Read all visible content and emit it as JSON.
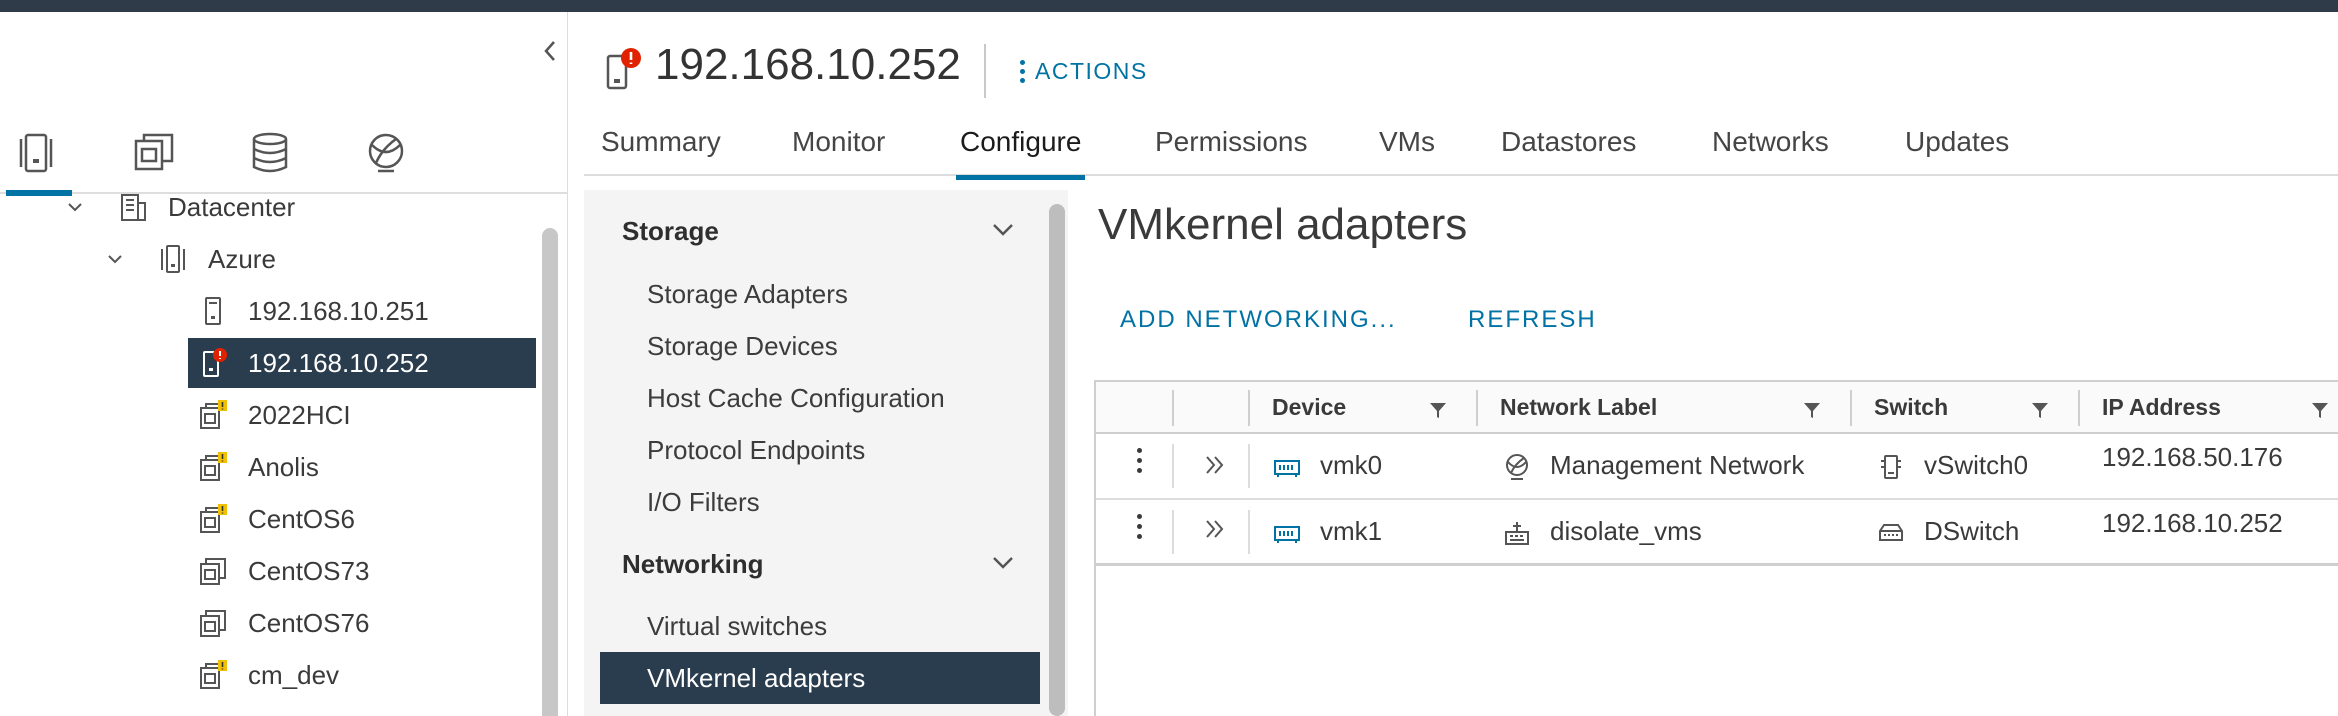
{
  "header": {
    "title": "192.168.10.252",
    "actions_label": "ACTIONS"
  },
  "tabs": [
    {
      "label": "Summary"
    },
    {
      "label": "Monitor"
    },
    {
      "label": "Configure"
    },
    {
      "label": "Permissions"
    },
    {
      "label": "VMs"
    },
    {
      "label": "Datastores"
    },
    {
      "label": "Networks"
    },
    {
      "label": "Updates"
    }
  ],
  "tree": {
    "items": [
      {
        "label": "Datacenter"
      },
      {
        "label": "Azure"
      },
      {
        "label": "192.168.10.251"
      },
      {
        "label": "192.168.10.252"
      },
      {
        "label": "2022HCI"
      },
      {
        "label": "Anolis"
      },
      {
        "label": "CentOS6"
      },
      {
        "label": "CentOS73"
      },
      {
        "label": "CentOS76"
      },
      {
        "label": "cm_dev"
      }
    ]
  },
  "config_menu": {
    "storage": {
      "title": "Storage",
      "items": [
        "Storage Adapters",
        "Storage Devices",
        "Host Cache Configuration",
        "Protocol Endpoints",
        "I/O Filters"
      ]
    },
    "networking": {
      "title": "Networking",
      "items": [
        "Virtual switches",
        "VMkernel adapters"
      ]
    }
  },
  "content": {
    "title": "VMkernel adapters",
    "add_networking": "ADD NETWORKING...",
    "refresh": "REFRESH"
  },
  "grid": {
    "columns": [
      "Device",
      "Network Label",
      "Switch",
      "IP Address"
    ],
    "rows": [
      {
        "device": "vmk0",
        "network_label": "Management Network",
        "switch": "vSwitch0",
        "ip": "192.168.50.176"
      },
      {
        "device": "vmk1",
        "network_label": "disolate_vms",
        "switch": "DSwitch",
        "ip": "192.168.10.252"
      }
    ]
  },
  "colors": {
    "accent": "#0072a3",
    "selected_bg": "#2a3d4f",
    "alert": "#e12200",
    "warning": "#efc006"
  }
}
